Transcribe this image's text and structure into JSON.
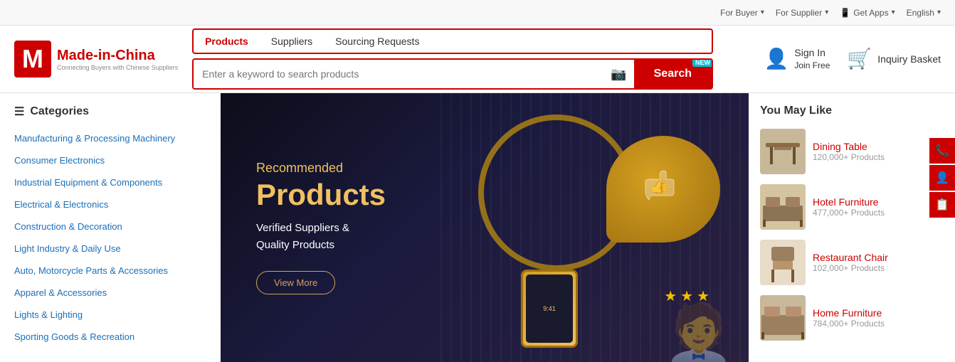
{
  "topbar": {
    "items": [
      {
        "label": "For Buyer",
        "id": "for-buyer"
      },
      {
        "label": "For Supplier",
        "id": "for-supplier"
      },
      {
        "label": "Get Apps",
        "id": "get-apps"
      },
      {
        "label": "English",
        "id": "language"
      }
    ]
  },
  "header": {
    "logo": {
      "title": "Made-in-China",
      "subtitle": "Connecting Buyers with Chinese Suppliers"
    },
    "nav": {
      "tabs": [
        {
          "label": "Products",
          "active": true,
          "id": "tab-products"
        },
        {
          "label": "Suppliers",
          "active": false,
          "id": "tab-suppliers"
        },
        {
          "label": "Sourcing Requests",
          "active": false,
          "id": "tab-sourcing"
        }
      ]
    },
    "search": {
      "placeholder": "Enter a keyword to search products",
      "button_label": "Search",
      "new_badge": "NEW"
    },
    "signin": {
      "line1": "Sign In",
      "line2": "Join Free"
    },
    "basket": {
      "label": "Inquiry Basket"
    }
  },
  "sidebar": {
    "title": "Categories",
    "items": [
      {
        "label": "Manufacturing & Processing Machinery",
        "id": "cat-manufacturing"
      },
      {
        "label": "Consumer Electronics",
        "id": "cat-electronics"
      },
      {
        "label": "Industrial Equipment & Components",
        "id": "cat-industrial"
      },
      {
        "label": "Electrical & Electronics",
        "id": "cat-electrical"
      },
      {
        "label": "Construction & Decoration",
        "id": "cat-construction"
      },
      {
        "label": "Light Industry & Daily Use",
        "id": "cat-light"
      },
      {
        "label": "Auto, Motorcycle Parts & Accessories",
        "id": "cat-auto"
      },
      {
        "label": "Apparel & Accessories",
        "id": "cat-apparel"
      },
      {
        "label": "Lights & Lighting",
        "id": "cat-lights"
      },
      {
        "label": "Sporting Goods & Recreation",
        "id": "cat-sporting"
      }
    ]
  },
  "banner": {
    "recommended": "Recommended",
    "products": "Products",
    "subtitle_line1": "Verified Suppliers &",
    "subtitle_line2": "Quality Products",
    "button_label": "View More"
  },
  "you_may_like": {
    "title": "You May Like",
    "products": [
      {
        "name": "Dining Table",
        "count": "120,000+ Products",
        "id": "prod-dining"
      },
      {
        "name": "Hotel Furniture",
        "count": "477,000+ Products",
        "id": "prod-hotel"
      },
      {
        "name": "Restaurant Chair",
        "count": "102,000+ Products",
        "id": "prod-restaurant"
      },
      {
        "name": "Home Furniture",
        "count": "784,000+ Products",
        "id": "prod-home"
      }
    ]
  },
  "float_buttons": [
    {
      "icon": "📞",
      "id": "float-contact"
    },
    {
      "icon": "👤",
      "id": "float-profile"
    },
    {
      "icon": "📋",
      "id": "float-clipboard"
    }
  ]
}
